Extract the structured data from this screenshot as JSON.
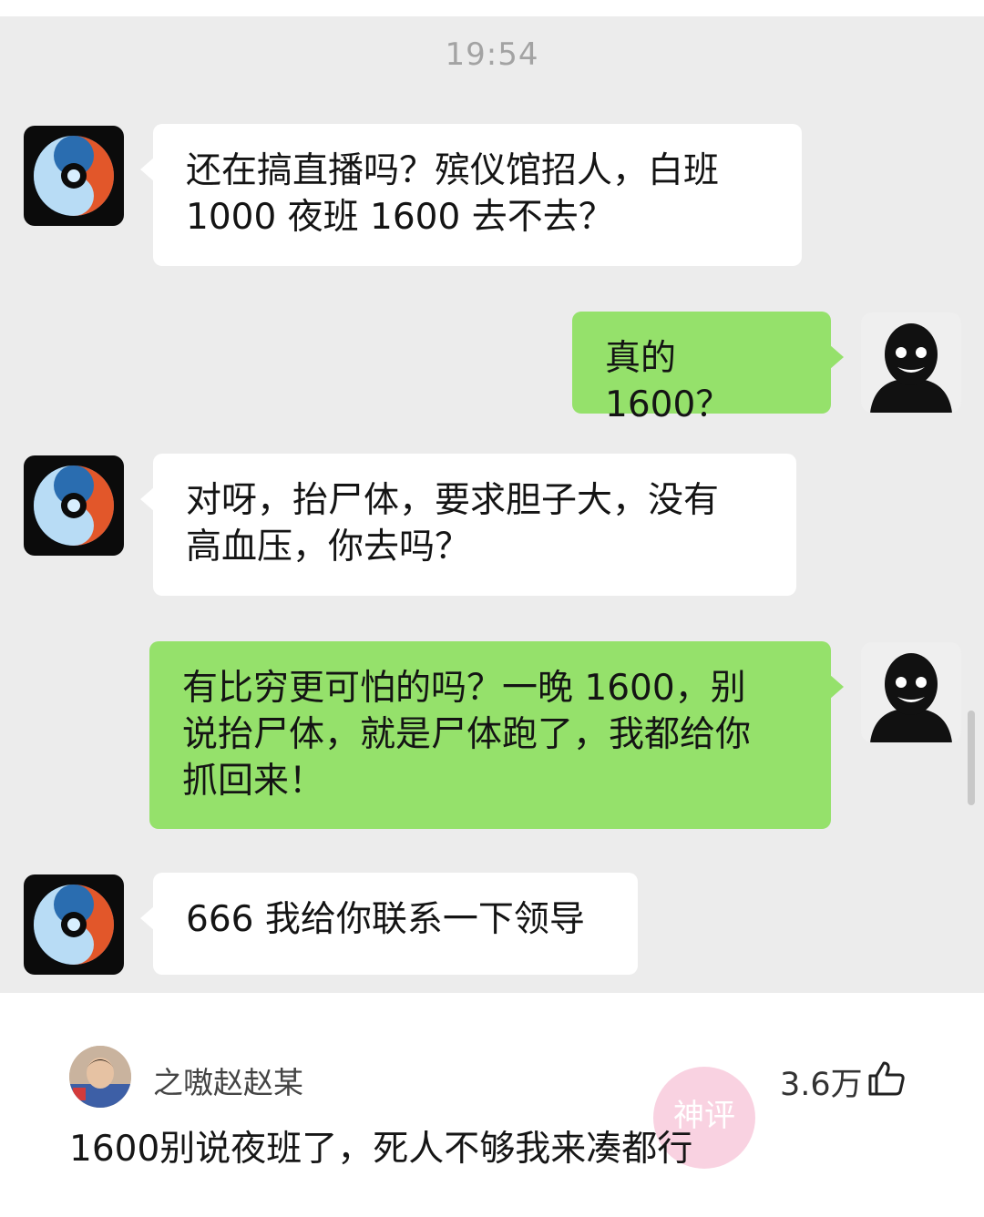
{
  "chat": {
    "timestamp": "19:54",
    "messages": [
      {
        "side": "in",
        "text": "还在搞直播吗？殡仪馆招人，白班\n1000 夜班 1600 去不去？"
      },
      {
        "side": "out",
        "text": "真的 1600？"
      },
      {
        "side": "in",
        "text": "对呀，抬尸体，要求胆子大，没有\n高血压，你去吗？"
      },
      {
        "side": "out",
        "text": "有比穷更可怕的吗？一晚 1600，别\n说抬尸体，就是尸体跑了，我都给你\n抓回来！"
      },
      {
        "side": "in",
        "text": "666 我给你联系一下领导"
      }
    ],
    "colors": {
      "incoming": "#ffffff",
      "outgoing": "#95e16b",
      "background": "#ececec"
    }
  },
  "comment": {
    "username": "之嗷赵赵某",
    "likes": "3.6万",
    "like_icon": "thumb-up-icon",
    "text": "1600别说夜班了，死人不够我来凑都行",
    "watermark_text": "神评"
  }
}
